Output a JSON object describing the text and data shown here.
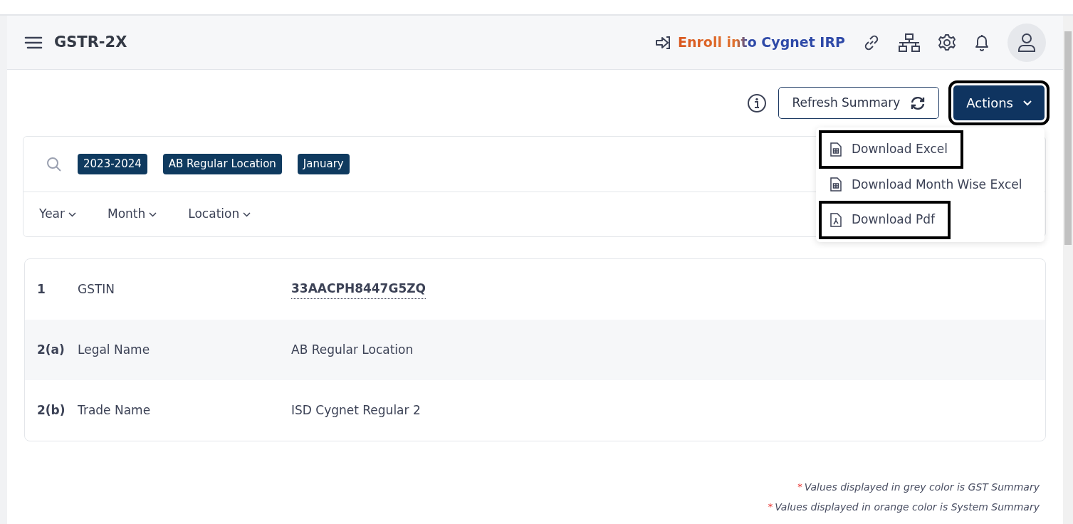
{
  "header": {
    "title": "GSTR-2X",
    "enroll_link": "Enroll into Cygnet IRP"
  },
  "toolbar": {
    "refresh_button": "Refresh Summary",
    "actions_button": {
      "label": "Actions",
      "highlighted": true,
      "expanded": true
    }
  },
  "actions_menu": [
    {
      "label": "Download Excel",
      "kind": "excel",
      "highlighted": true
    },
    {
      "label": "Download Month Wise Excel",
      "kind": "excel",
      "highlighted": false
    },
    {
      "label": "Download Pdf",
      "kind": "pdf",
      "highlighted": true
    }
  ],
  "filter_chips": [
    "2023-2024",
    "AB Regular Location",
    "January"
  ],
  "filter_dropdowns": [
    "Year",
    "Month",
    "Location"
  ],
  "details": [
    {
      "number": "1",
      "label": "GSTIN",
      "value": "33AACPH8447G5ZQ",
      "kind": "link"
    },
    {
      "number": "2(a)",
      "label": "Legal Name",
      "value": "AB Regular Location",
      "kind": "text"
    },
    {
      "number": "2(b)",
      "label": "Trade Name",
      "value": "ISD Cygnet Regular 2",
      "kind": "text"
    }
  ],
  "footnotes": [
    {
      "marker": "*",
      "text": "Values displayed in grey color is GST Summary"
    },
    {
      "marker": "*",
      "text": "Values displayed in orange color is System Summary"
    }
  ]
}
